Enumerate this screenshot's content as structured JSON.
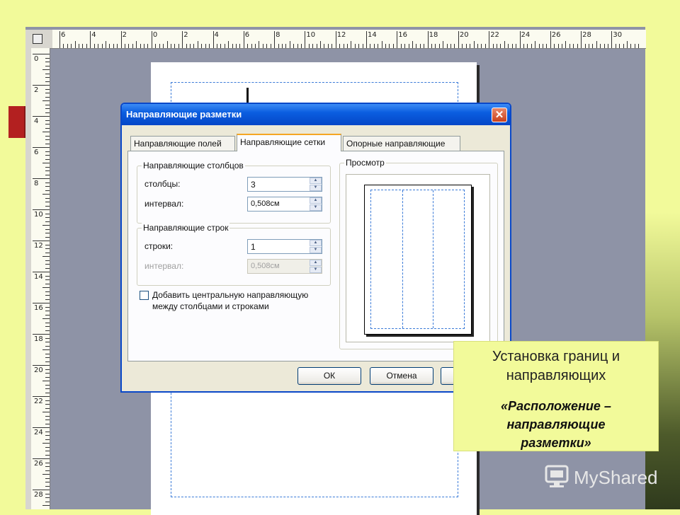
{
  "ruler": {
    "top_labels": [
      "6",
      "4",
      "2",
      "0",
      "2",
      "4",
      "6",
      "8",
      "10",
      "12",
      "14",
      "16",
      "18",
      "20",
      "22",
      "24",
      "26",
      "28",
      "30"
    ],
    "left_labels": [
      "0",
      "2",
      "4",
      "6",
      "8",
      "10",
      "12",
      "14",
      "16",
      "18",
      "20",
      "22",
      "24",
      "26",
      "28"
    ]
  },
  "dialog": {
    "title": "Направляющие разметки",
    "close_glyph": "✕",
    "tabs": [
      {
        "label": "Направляющие полей",
        "active": false
      },
      {
        "label": "Направляющие сетки",
        "active": true
      },
      {
        "label": "Опорные направляющие",
        "active": false
      }
    ],
    "columns_group": {
      "title": "Направляющие столбцов",
      "columns_label": "столбцы:",
      "columns_value": "3",
      "spacing_label": "интервал:",
      "spacing_value": "0,508см"
    },
    "rows_group": {
      "title": "Направляющие строк",
      "rows_label": "строки:",
      "rows_value": "1",
      "spacing_label": "интервал:",
      "spacing_value": "0,508см"
    },
    "checkbox": {
      "label_line1": "Добавить центральную направляющую",
      "label_line2": "между столбцами и строками",
      "checked": false
    },
    "preview": {
      "title": "Просмотр",
      "columns": 3
    },
    "buttons": {
      "ok": "ОК",
      "cancel": "Отмена"
    }
  },
  "note": {
    "line1": "Установка границ и",
    "line2": "направляющих",
    "sub1": "«Расположение –",
    "sub2": "направляющие",
    "sub3": "разметки»"
  },
  "watermark": {
    "text": "MyShared",
    "icon": "myshared-logo-icon"
  },
  "colors": {
    "background": "#f2fa9a",
    "workspace": "#8e93a6",
    "titlebar": "#0b5ee0",
    "guide": "#3b7bd8",
    "close": "#c9401c"
  }
}
